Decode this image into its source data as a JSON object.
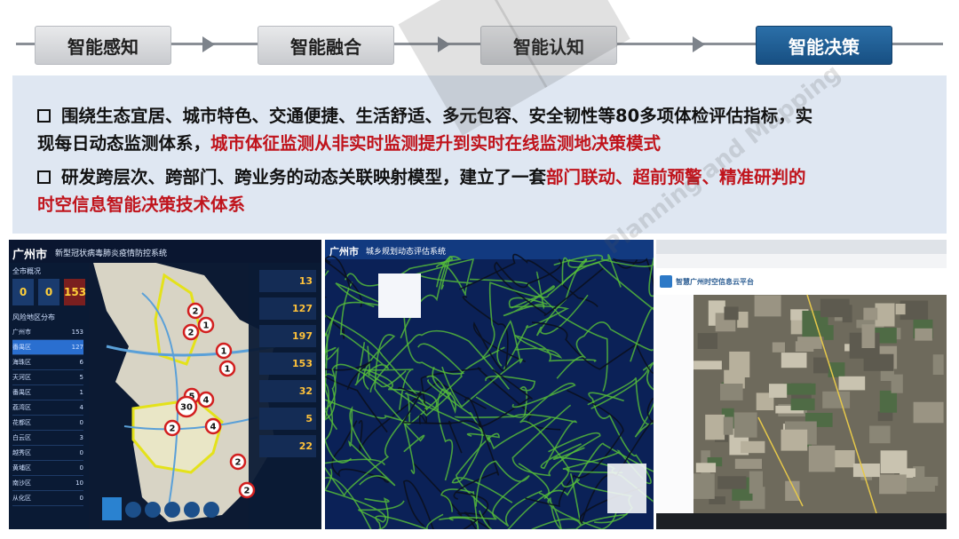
{
  "steps": [
    "智能感知",
    "智能融合",
    "智能认知",
    "智能决策"
  ],
  "bullets": [
    {
      "lines": [
        [
          {
            "t": "围绕生态宜居、城市特色、交通便捷、生活舒适、多元包容、安全韧性等80多项体检评估指标，实",
            "red": false
          }
        ],
        [
          {
            "t": "现每日动态监测体系，",
            "red": false
          },
          {
            "t": "城市体征监测从非实时监测提升到实时在线监测地决策模式",
            "red": true
          }
        ]
      ]
    },
    {
      "lines": [
        [
          {
            "t": "研发跨层次、跨部门、跨业务的动态关联映射模型，建立了一套",
            "red": false
          },
          {
            "t": "部门联动、超前预警、精准研判的",
            "red": true
          }
        ],
        [
          {
            "t": "时空信息智能决策技术体系",
            "red": true
          }
        ]
      ]
    }
  ],
  "shot1": {
    "city": "广州市",
    "title": "新型冠状病毒肺炎疫情防控系统",
    "panel_title": "全市概况",
    "stats": [
      "0",
      "0",
      "153"
    ],
    "district_header": [
      "风险地区分布",
      ""
    ],
    "districts": [
      {
        "name": "广州市",
        "val": "153"
      },
      {
        "name": "番禺区",
        "val": "127"
      },
      {
        "name": "海珠区",
        "val": "6"
      },
      {
        "name": "天河区",
        "val": "5"
      },
      {
        "name": "番禺区",
        "val": "1"
      },
      {
        "name": "荔湾区",
        "val": "4"
      },
      {
        "name": "花都区",
        "val": "0"
      },
      {
        "name": "白云区",
        "val": "3"
      },
      {
        "name": "越秀区",
        "val": "0"
      },
      {
        "name": "黄埔区",
        "val": "0"
      },
      {
        "name": "南沙区",
        "val": "10"
      },
      {
        "name": "从化区",
        "val": "0"
      }
    ],
    "right_nums": [
      "13",
      "127",
      "197",
      "153",
      "32",
      "5",
      "22"
    ],
    "markers": [
      "2",
      "2",
      "1",
      "1",
      "1",
      "4",
      "5",
      "30",
      "2",
      "4",
      "2",
      "2"
    ]
  },
  "shot2": {
    "city": "广州市",
    "title": "城乡规划动态评估系统"
  },
  "shot3": {
    "title": "智慧广州时空信息云平台"
  },
  "watermark": "Planning and Mapping"
}
